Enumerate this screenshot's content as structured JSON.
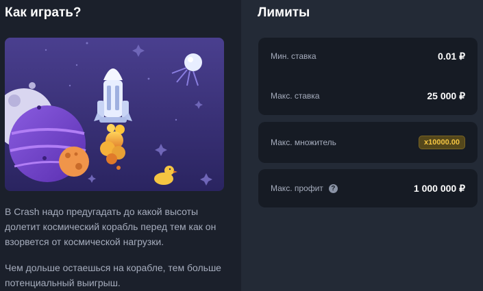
{
  "how_to_play": {
    "title": "Как играть?",
    "paragraph1": "В Crash надо предугадать до какой высоты долетит космический корабль перед тем как он взорвется от космической нагрузки.",
    "paragraph2": "Чем дольше остаешься на корабле, тем больше потенциальный выигрыш."
  },
  "limits": {
    "title": "Лимиты",
    "min_bet_label": "Мин. ставка",
    "min_bet_value": "0.01 ₽",
    "max_bet_label": "Макс. ставка",
    "max_bet_value": "25 000 ₽",
    "max_multiplier_label": "Макс. множитель",
    "max_multiplier_value": "x10000.00",
    "max_profit_label": "Макс. профит",
    "max_profit_help": "?",
    "max_profit_value": "1 000 000 ₽"
  },
  "colors": {
    "badge_text": "#f5c542",
    "badge_bg": "#54471b"
  }
}
